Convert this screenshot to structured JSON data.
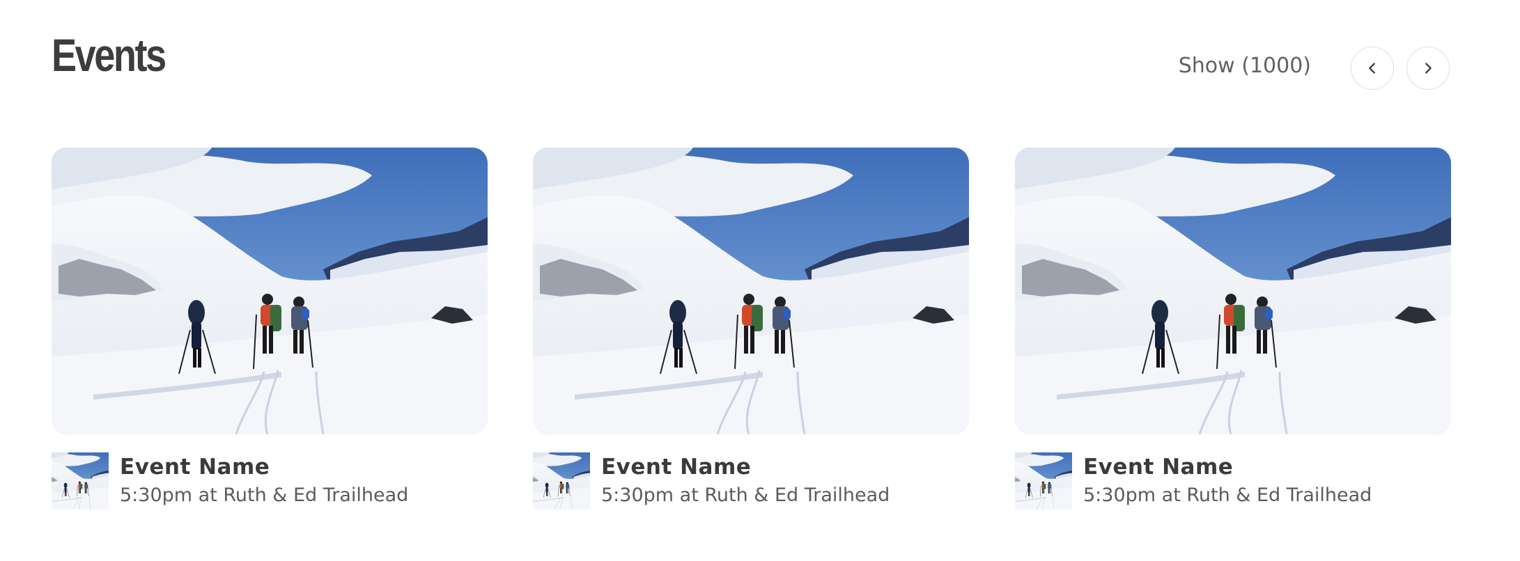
{
  "header": {
    "title": "Events",
    "show_label": "Show (1000)",
    "prev_icon": "chevron-left-icon",
    "next_icon": "chevron-right-icon"
  },
  "events": [
    {
      "name": "Event Name",
      "details": "5:30pm at Ruth & Ed Trailhead",
      "image": "snowy-mountain-ski-tour-photo"
    },
    {
      "name": "Event Name",
      "details": "5:30pm at Ruth & Ed Trailhead",
      "image": "snowy-mountain-ski-tour-photo"
    },
    {
      "name": "Event Name",
      "details": "5:30pm at Ruth & Ed Trailhead",
      "image": "snowy-mountain-ski-tour-photo"
    }
  ],
  "colors": {
    "title": "#3d3d3d",
    "sky": "#4f7ec4",
    "snow": "#f2f4f8",
    "border": "#dedede"
  }
}
